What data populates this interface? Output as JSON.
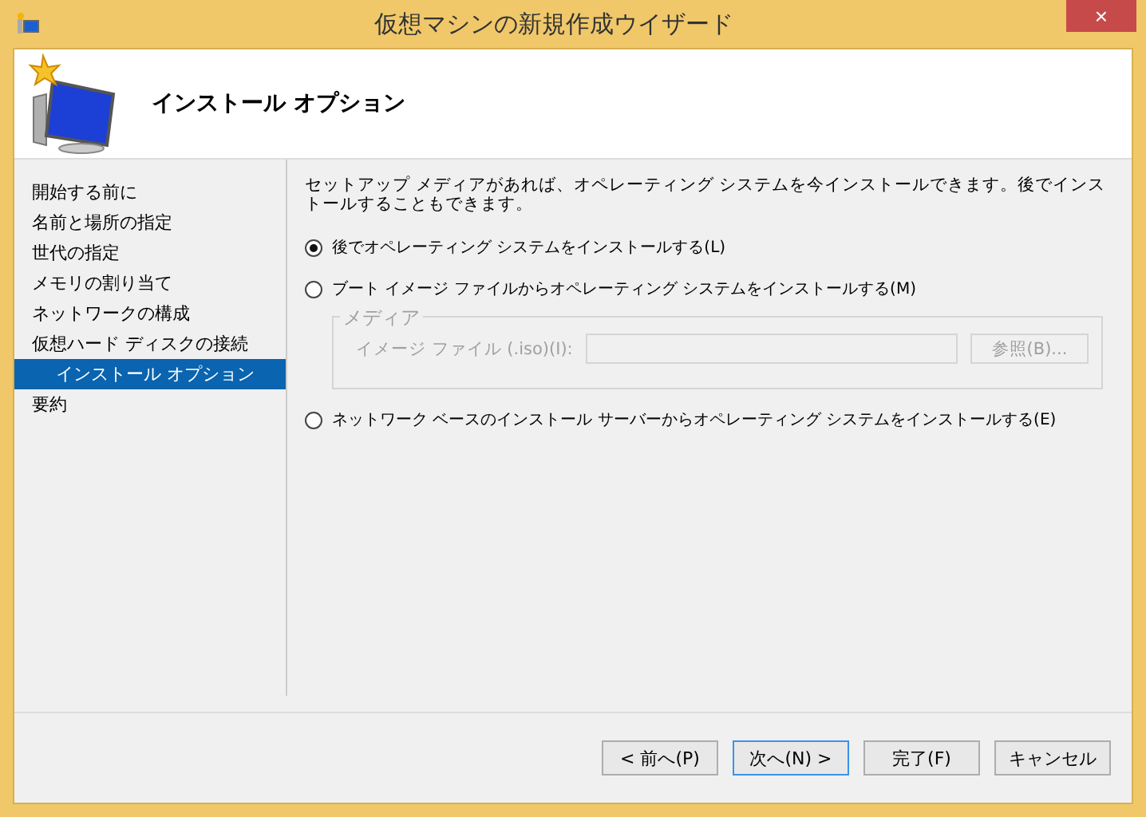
{
  "window": {
    "title": "仮想マシンの新規作成ウイザード",
    "close": "×"
  },
  "header": {
    "title": "インストール オプション"
  },
  "sidebar": {
    "items": [
      {
        "label": "開始する前に",
        "selected": false
      },
      {
        "label": "名前と場所の指定",
        "selected": false
      },
      {
        "label": "世代の指定",
        "selected": false
      },
      {
        "label": "メモリの割り当て",
        "selected": false
      },
      {
        "label": "ネットワークの構成",
        "selected": false
      },
      {
        "label": "仮想ハード ディスクの接続",
        "selected": false
      },
      {
        "label": "インストール オプション",
        "selected": true,
        "indented": true
      },
      {
        "label": "要約",
        "selected": false
      }
    ]
  },
  "description": "セットアップ メディアがあれば、オペレーティング システムを今インストールできます。後でインストールすることもできます。",
  "options": [
    {
      "label": "後でオペレーティング システムをインストールする(L)",
      "selected": true
    },
    {
      "label": "ブート イメージ ファイルからオペレーティング システムをインストールする(M)",
      "selected": false
    },
    {
      "label": "ネットワーク ベースのインストール サーバーからオペレーティング システムをインストールする(E)",
      "selected": false
    }
  ],
  "media": {
    "legend": "メディア",
    "label": "イメージ ファイル (.iso)(I):",
    "browse": "参照(B)...",
    "disabled": true
  },
  "buttons": [
    {
      "label": "< 前へ(P)",
      "default": false
    },
    {
      "label": "次へ(N) >",
      "default": true
    },
    {
      "label": "完了(F)",
      "default": false
    },
    {
      "label": "キャンセル",
      "default": false
    }
  ]
}
